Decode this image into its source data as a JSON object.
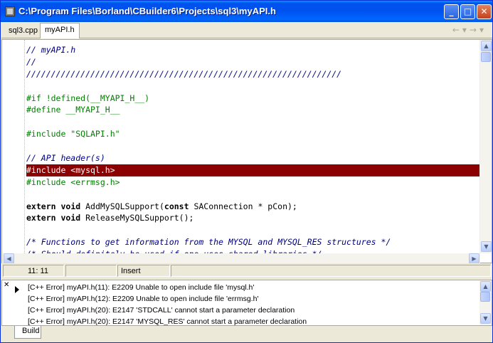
{
  "window": {
    "title": "C:\\Program Files\\Borland\\CBuilder6\\Projects\\sql3\\myAPI.h",
    "minimize_glyph": "_",
    "maximize_glyph": "□",
    "close_glyph": "✕"
  },
  "tabs": [
    {
      "label": "sql3.cpp",
      "active": false
    },
    {
      "label": "myAPI.h",
      "active": true
    }
  ],
  "nav": {
    "back_glyph": "←",
    "dropdown_glyph": "▾",
    "forward_glyph": "→"
  },
  "code_lines": [
    {
      "text": "// myAPI.h",
      "kind": "comment"
    },
    {
      "text": "//",
      "kind": "comment"
    },
    {
      "text": "////////////////////////////////////////////////////////////////",
      "kind": "comment"
    },
    {
      "text": "",
      "kind": "plain"
    },
    {
      "text": "#if !defined(__MYAPI_H__)",
      "kind": "pre"
    },
    {
      "text": "#define __MYAPI_H__",
      "kind": "pre"
    },
    {
      "text": "",
      "kind": "plain"
    },
    {
      "text": "#include \"SQLAPI.h\"",
      "kind": "pre"
    },
    {
      "text": "",
      "kind": "plain"
    },
    {
      "text": "// API header(s)",
      "kind": "comment"
    },
    {
      "text": "#include <mysql.h>",
      "kind": "highlight"
    },
    {
      "text": "#include <errmsg.h>",
      "kind": "pre"
    },
    {
      "text": "",
      "kind": "plain"
    },
    {
      "text": "extern void AddMySQLSupport(const SAConnection * pCon);",
      "kind": "mixed1"
    },
    {
      "text": "extern void ReleaseMySQLSupport();",
      "kind": "mixed2"
    },
    {
      "text": "",
      "kind": "plain"
    },
    {
      "text": "/* Functions to get information from the MYSQL and MYSQL_RES structures */",
      "kind": "comment"
    },
    {
      "text": "/* Should definitely be used if one uses shared libraries */",
      "kind": "comment"
    }
  ],
  "status": {
    "position": "11: 11",
    "modified": "",
    "mode": "Insert"
  },
  "messages": [
    "[C++ Error] myAPI.h(11): E2209 Unable to open include file 'mysql.h'",
    "[C++ Error] myAPI.h(12): E2209 Unable to open include file 'errmsg.h'",
    "[C++ Error] myAPI.h(20): E2147 'STDCALL' cannot start a parameter declaration",
    "[C++ Error] myAPI.h(20): E2147 'MYSQL_RES' cannot start a parameter declaration"
  ],
  "build_tab": "Build",
  "colors": {
    "titlebar": "#0053ee",
    "highlight_line": "#8b0000",
    "preprocessor": "#008000",
    "comment": "#000080"
  }
}
